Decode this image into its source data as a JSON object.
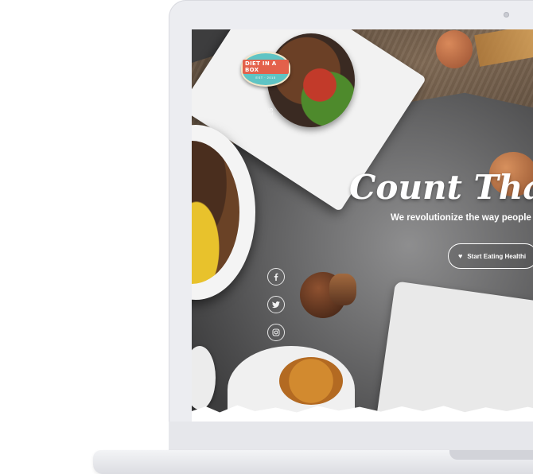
{
  "site": {
    "logo_text": "DIET IN A BOX",
    "logo_sub": "EST · 2015",
    "estd_text": "ESTD 2015"
  },
  "hero": {
    "title": "Count That",
    "subtitle": "We revolutionize the way people p",
    "cta_label": "Start Eating Healthi",
    "cta_icon": "heart-icon"
  },
  "social": [
    {
      "name": "facebook-icon"
    },
    {
      "name": "twitter-icon"
    },
    {
      "name": "instagram-icon"
    }
  ],
  "colors": {
    "logo_teal": "#5fc4c4",
    "logo_red": "#e3614b",
    "laptop": "#ecedf1",
    "text": "#ffffff"
  }
}
